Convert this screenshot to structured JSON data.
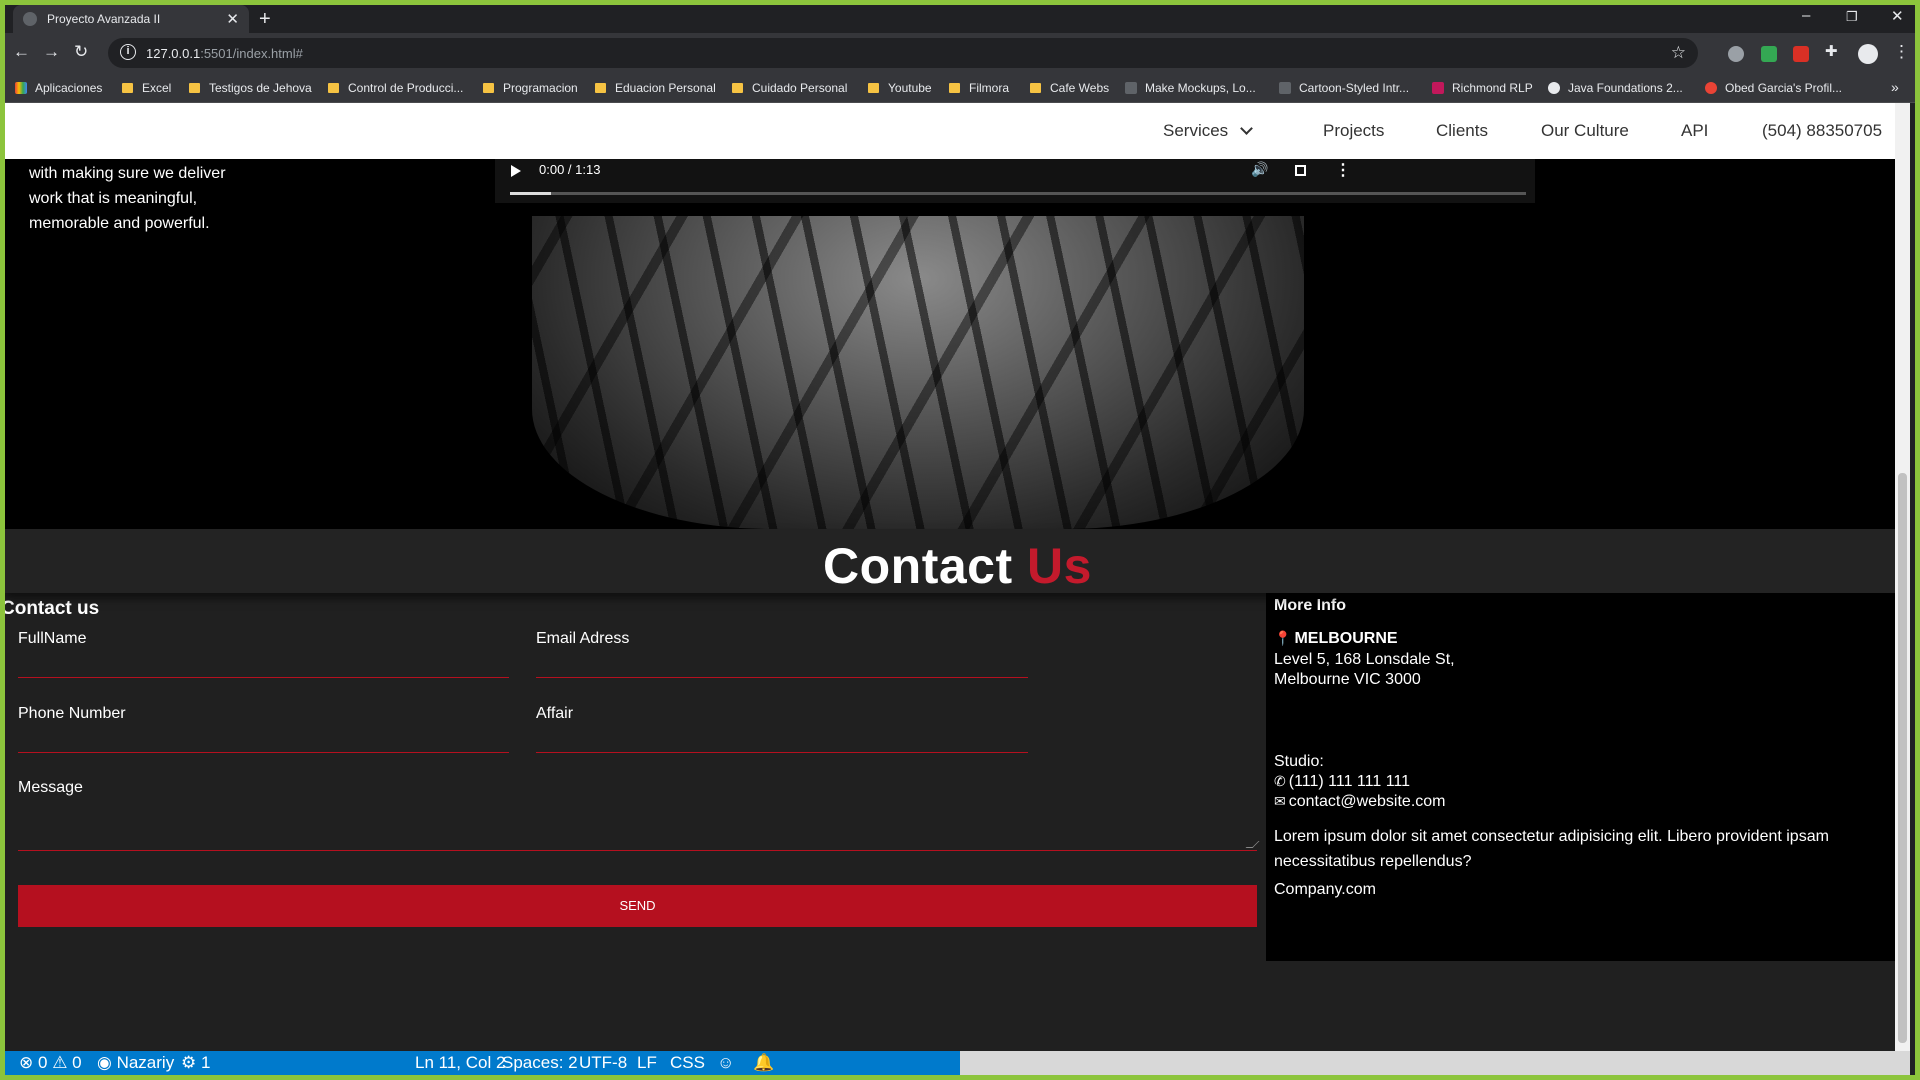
{
  "browser": {
    "tab_title": "Proyecto Avanzada II",
    "url_host": "127.0.0.1",
    "url_rest": ":5501/index.html#",
    "bookmarks": [
      "Aplicaciones",
      "Excel",
      "Testigos de Jehova",
      "Control de Producci...",
      "Programacion",
      "Eduacion Personal",
      "Cuidado Personal",
      "Youtube",
      "Filmora",
      "Cafe Webs",
      "Make Mockups, Lo...",
      "Cartoon-Styled Intr...",
      "Richmond RLP",
      "Java Foundations 2...",
      "Obed Garcia's Profil..."
    ]
  },
  "site_nav": {
    "services": "Services",
    "projects": "Projects",
    "clients": "Clients",
    "culture": "Our Culture",
    "api": "API",
    "phone": "(504) 88350705"
  },
  "hero": {
    "lines": [
      "with making sure we deliver",
      "work that is meaningful,",
      "memorable and powerful."
    ],
    "video_time": "0:00 / 1:13",
    "video_progress": 0.04
  },
  "contact": {
    "title": "Contact",
    "title_accent": "Us",
    "form_heading": "Contact us",
    "fullname_label": "FullName",
    "email_label": "Email Adress",
    "phone_label": "Phone Number",
    "affair_label": "Affair",
    "message_label": "Message",
    "send_label": "SEND"
  },
  "more_info": {
    "title": "More Info",
    "city": "MELBOURNE",
    "address1": "Level 5, 168 Lonsdale St,",
    "address2": "Melbourne VIC 3000",
    "studio": "Studio:",
    "phone": "(111) 111 111 111",
    "email": "contact@website.com",
    "description": "Lorem ipsum dolor sit amet consectetur adipisicing elit. Libero provident ipsam necessitatibus repellendus?",
    "company": "Company.com"
  },
  "statusbar": {
    "errors": "0",
    "warnings": "0",
    "user": "Nazariy",
    "ports": "1",
    "position": "Ln 11, Col 2",
    "spaces": "Spaces: 2",
    "encoding": "UTF-8",
    "eol": "LF",
    "language": "CSS"
  },
  "colors": {
    "accent": "#b5101f",
    "statusbar": "#007acc",
    "window_border": "#8cc43c"
  }
}
